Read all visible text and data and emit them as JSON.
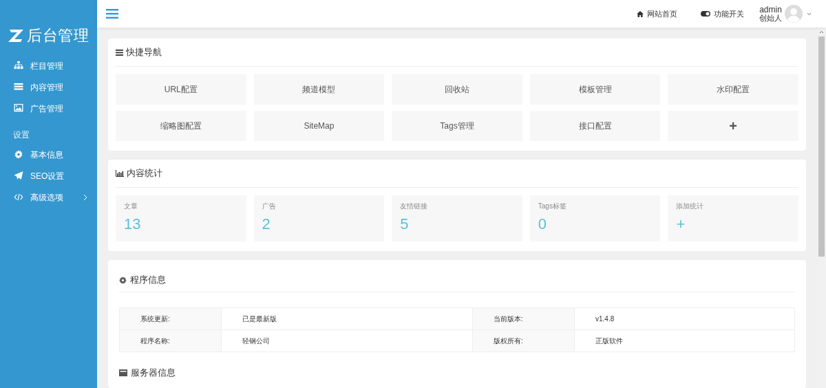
{
  "sidebar": {
    "logo": "后台管理",
    "items": [
      {
        "label": "栏目管理",
        "kind": "sitemap"
      },
      {
        "label": "内容管理",
        "kind": "list"
      },
      {
        "label": "广告管理",
        "kind": "image"
      }
    ],
    "section_title": "设置",
    "settings_items": [
      {
        "label": "基本信息",
        "kind": "gear",
        "expandable": false
      },
      {
        "label": "SEO设置",
        "kind": "plane",
        "expandable": false
      },
      {
        "label": "高级选项",
        "kind": "code",
        "expandable": true
      }
    ]
  },
  "header": {
    "links": [
      {
        "label": "网站首页",
        "kind": "home"
      },
      {
        "label": "功能开关",
        "kind": "toggle"
      }
    ],
    "user": {
      "name": "admin",
      "role": "创始人"
    }
  },
  "quick_nav": {
    "title": "快捷导航",
    "items": [
      {
        "label": "URL配置",
        "kind": "text"
      },
      {
        "label": "频道模型",
        "kind": "text"
      },
      {
        "label": "回收站",
        "kind": "text"
      },
      {
        "label": "模板管理",
        "kind": "text"
      },
      {
        "label": "水印配置",
        "kind": "text"
      },
      {
        "label": "缩略图配置",
        "kind": "text"
      },
      {
        "label": "SiteMap",
        "kind": "text"
      },
      {
        "label": "Tags管理",
        "kind": "text"
      },
      {
        "label": "接口配置",
        "kind": "text"
      },
      {
        "label": "+",
        "kind": "add"
      }
    ]
  },
  "stats": {
    "title": "内容统计",
    "items": [
      {
        "label": "文章",
        "value": "13"
      },
      {
        "label": "广告",
        "value": "2"
      },
      {
        "label": "友情链接",
        "value": "5"
      },
      {
        "label": "Tags标签",
        "value": "0"
      },
      {
        "label": "添加统计",
        "value": "+"
      }
    ]
  },
  "program_info": {
    "title": "程序信息",
    "rows": [
      [
        "系统更新:",
        "已是最新版",
        "当前版本:",
        "v1.4.8"
      ],
      [
        "程序名称:",
        "轻钢公司",
        "版权所有:",
        "正版软件"
      ]
    ]
  },
  "server_info": {
    "title": "服务器信息"
  }
}
